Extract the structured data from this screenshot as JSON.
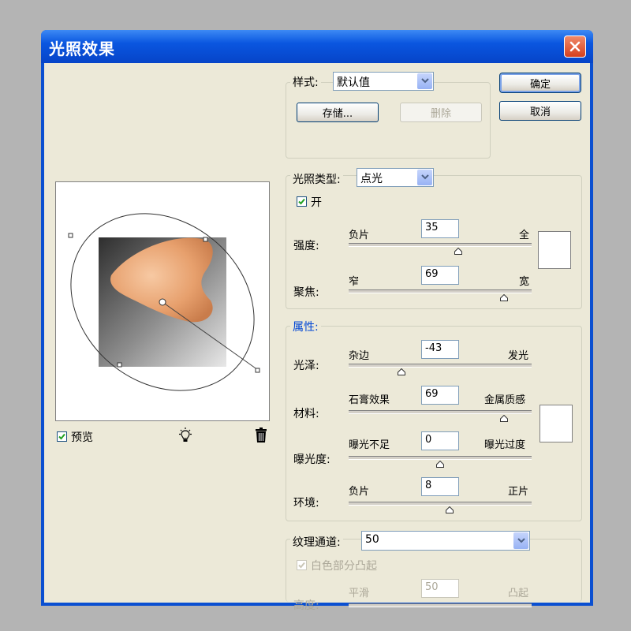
{
  "window": {
    "title": "光照效果"
  },
  "buttons": {
    "ok": "确定",
    "cancel": "取消",
    "save": "存储...",
    "delete": "删除"
  },
  "style": {
    "label": "样式:",
    "value": "默认值"
  },
  "light_type": {
    "label": "光照类型:",
    "value": "点光",
    "on_label": "开",
    "on_checked": true
  },
  "intensity": {
    "label": "强度:",
    "min_label": "负片",
    "max_label": "全",
    "value": "35",
    "fraction": 0.6
  },
  "focus": {
    "label": "聚焦:",
    "min_label": "窄",
    "max_label": "宽",
    "value": "69",
    "fraction": 0.85
  },
  "properties": {
    "label": "属性:",
    "gloss": {
      "label": "光泽:",
      "min_label": "杂边",
      "max_label": "发光",
      "value": "-43",
      "fraction": 0.29
    },
    "material": {
      "label": "材料:",
      "min_label": "石膏效果",
      "max_label": "金属质感",
      "value": "69",
      "fraction": 0.85
    },
    "exposure": {
      "label": "曝光度:",
      "min_label": "曝光不足",
      "max_label": "曝光过度",
      "value": "0",
      "fraction": 0.5
    },
    "ambience": {
      "label": "环境:",
      "min_label": "负片",
      "max_label": "正片",
      "value": "8",
      "fraction": 0.55
    }
  },
  "texture": {
    "label": "纹理通道:",
    "value": "50",
    "white_high_label": "白色部分凸起",
    "white_high_checked": true,
    "height_label": "高度:",
    "min_label": "平滑",
    "max_label": "凸起",
    "fraction": 0.5
  },
  "preview": {
    "label": "预览",
    "checked": true
  },
  "icons": {
    "light_bulb": "light-bulb-icon",
    "trash": "trash-icon",
    "close": "close-icon",
    "check": "check-icon"
  },
  "colors": {
    "title_bar": "#0a56e0",
    "face": "#ece9d8",
    "close": "#d5401f"
  }
}
